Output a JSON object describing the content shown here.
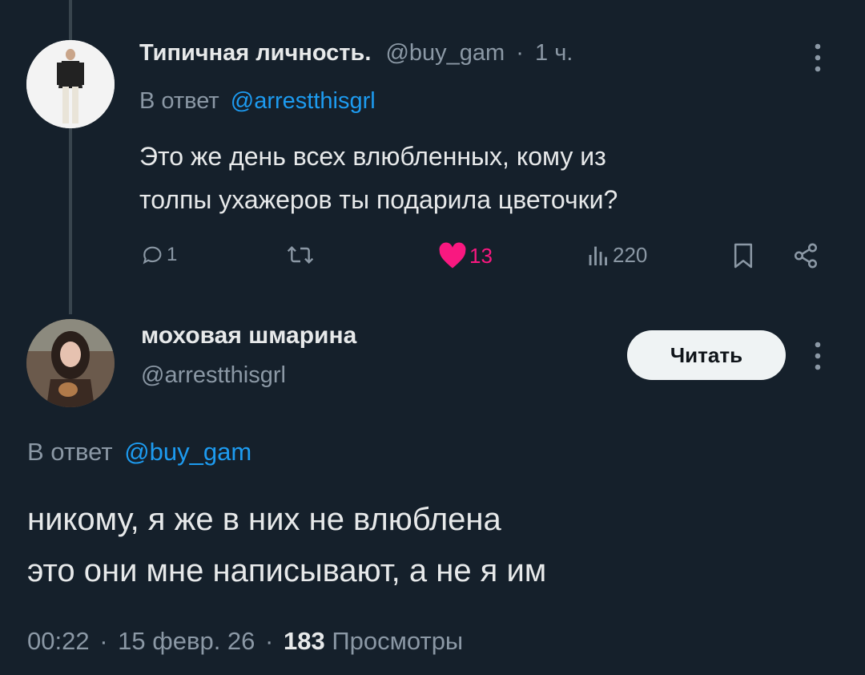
{
  "reply_tweet": {
    "author_name": "Типичная личность.",
    "handle": "@buy_gam",
    "separator": "·",
    "time": "1 ч.",
    "reply_prefix": "В ответ",
    "reply_to": "@arrestthisgrl",
    "text_line1": "Это же день всех влюбленных, кому из",
    "text_line2": "толпы ухажеров ты подарила цветочки?",
    "stats": {
      "replies": "1",
      "likes": "13",
      "views": "220"
    },
    "colors": {
      "like": "#f91880"
    }
  },
  "main_tweet": {
    "author_name": "моховая шмарина",
    "handle": "@arrestthisgrl",
    "follow_label": "Читать",
    "reply_prefix": "В ответ",
    "reply_to": "@buy_gam",
    "text_line1": "никому, я же в них не влюблена",
    "text_line2": "это они мне написывают, а не я им",
    "meta": {
      "time": "00:22",
      "sep1": "·",
      "date": "15 февр. 26",
      "sep2": "·",
      "views_count": "183",
      "views_label": "Просмотры"
    }
  },
  "icons": [
    "reply-icon",
    "retweet-icon",
    "heart-icon",
    "views-icon",
    "bookmark-icon",
    "share-icon",
    "more-icon"
  ]
}
